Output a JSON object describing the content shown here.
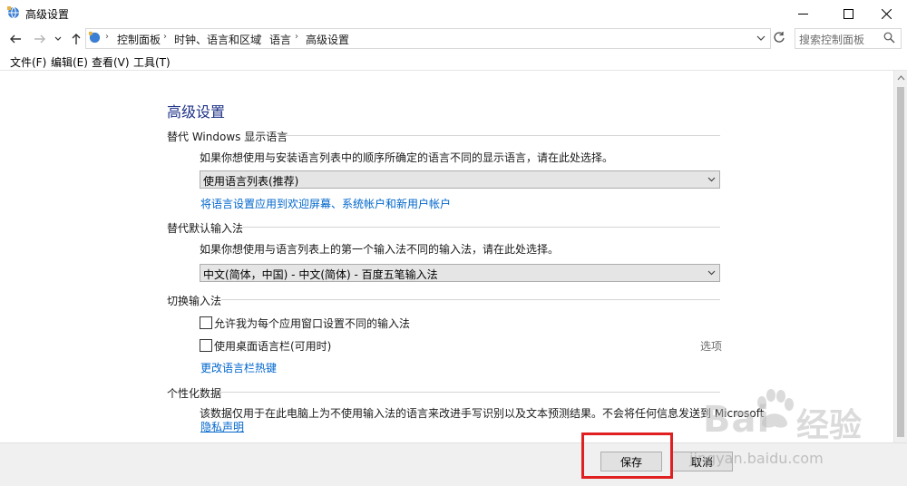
{
  "window": {
    "title": "高级设置"
  },
  "nav": {
    "breadcrumbs": [
      "控制面板",
      "时钟、语言和区域",
      "语言",
      "高级设置"
    ],
    "search_placeholder": "搜索控制面板"
  },
  "menu": {
    "items": [
      "文件(F)",
      "编辑(E)",
      "查看(V)",
      "工具(T)"
    ]
  },
  "page": {
    "heading": "高级设置",
    "display_lang": {
      "title": "替代 Windows 显示语言",
      "description": "如果你想使用与安装语言列表中的顺序所确定的语言不同的显示语言，请在此处选择。",
      "selected": "使用语言列表(推荐)",
      "link": "将语言设置应用到欢迎屏幕、系统帐户和新用户帐户"
    },
    "input_method": {
      "title": "替代默认输入法",
      "description": "如果你想使用与语言列表上的第一个输入法不同的输入法，请在此处选择。",
      "selected": "中文(简体，中国) - 中文(简体) - 百度五笔输入法"
    },
    "switch_input": {
      "title": "切换输入法",
      "checkbox1": "允许我为每个应用窗口设置不同的输入法",
      "checkbox2": "使用桌面语言栏(可用时)",
      "options_link": "选项",
      "hotkey_link": "更改语言栏热键"
    },
    "personalization": {
      "title": "个性化数据",
      "description": "该数据仅用于在此电脑上为不使用输入法的语言来改进手写识别以及文本预测结果。不会将任何信息发送到 Microsoft",
      "privacy_link": "隐私声明"
    }
  },
  "footer": {
    "save_label": "保存",
    "cancel_label": "取消"
  },
  "watermark": {
    "brand": "Bai",
    "brand2": "经验",
    "url": "jingyan.baidu.com"
  },
  "colors": {
    "heading": "#1e3287",
    "link": "#0066cc",
    "highlight": "#e02020"
  }
}
